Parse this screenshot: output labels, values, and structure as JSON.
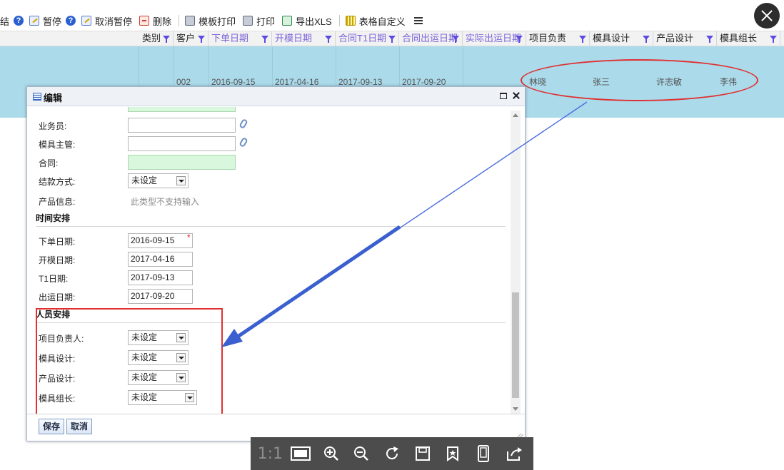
{
  "toolbar": {
    "partial_label": "结",
    "pause_label": "暂停",
    "unpause_label": "取消暂停",
    "delete_label": "删除",
    "template_print_label": "模板打印",
    "print_label": "打印",
    "export_label": "导出XLS",
    "customize_label": "表格自定义",
    "help_glyph": "?"
  },
  "grid": {
    "columns": [
      "类别",
      "客户",
      "下单日期",
      "开模日期",
      "合同T1日期",
      "合同出运日期",
      "实际出运日期",
      "项目负责",
      "模具设计",
      "产品设计",
      "模具组长"
    ],
    "row": {
      "customer": "002",
      "order_date": "2016-09-15",
      "mold_open_date": "2017-04-16",
      "t1_date": "2017-09-13",
      "ship_date": "2017-09-20",
      "project_lead": "林晓",
      "mold_design": "张三",
      "product_design": "许志敏",
      "mold_leader": "李伟"
    }
  },
  "dialog": {
    "title": "编辑",
    "fields": {
      "salesperson_label": "业务员:",
      "mold_manager_label": "模具主管:",
      "contract_label": "合同:",
      "payment_label": "结款方式:",
      "payment_value": "未设定",
      "product_info_label": "产品信息:",
      "product_info_hint": "此类型不支持输入"
    },
    "schedule": {
      "title": "时间安排",
      "order_date_label": "下单日期:",
      "order_date_value": "2016-09-15",
      "required_mark": "*",
      "mold_open_label": "开模日期:",
      "mold_open_value": "2017-04-16",
      "t1_label": "T1日期:",
      "t1_value": "2017-09-13",
      "ship_label": "出运日期:",
      "ship_value": "2017-09-20"
    },
    "staff": {
      "title": "人员安排",
      "project_lead_label": "项目负责人:",
      "project_lead_value": "未设定",
      "mold_design_label": "模具设计:",
      "mold_design_value": "未设定",
      "product_design_label": "产品设计:",
      "product_design_value": "未设定",
      "mold_leader_label": "模具组长:",
      "mold_leader_value": "未设定"
    },
    "save_label": "保存",
    "cancel_label": "取消"
  },
  "viewer": {
    "ratio_label": "1:1"
  },
  "colors": {
    "selected_row": "#abdaea",
    "annotation_red": "#e03030",
    "annotation_arrow": "#3a5fcf"
  }
}
